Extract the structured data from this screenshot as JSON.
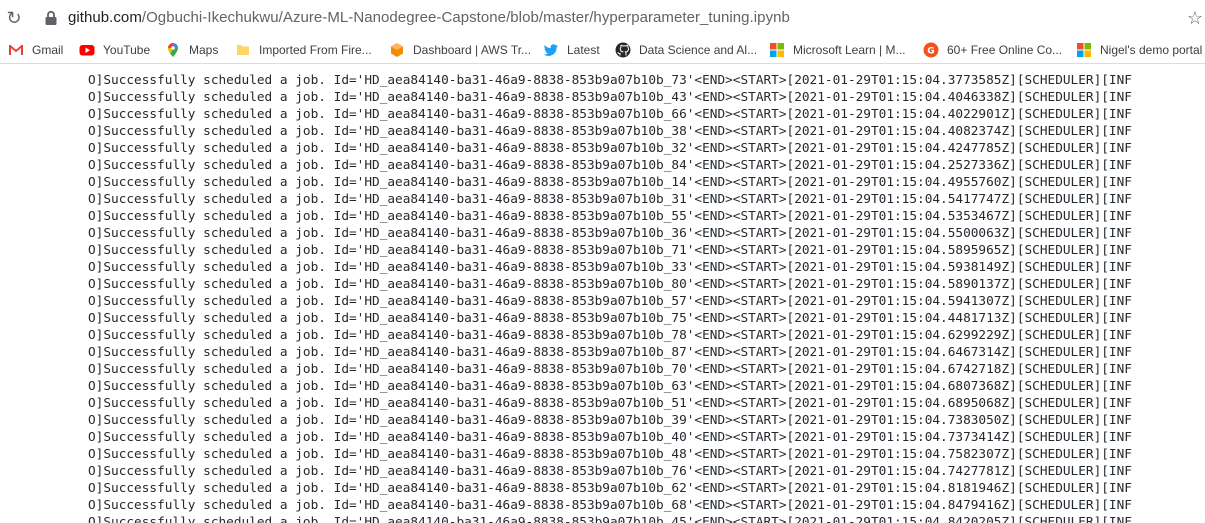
{
  "browser": {
    "url_host": "github.com",
    "url_path": "/Ogbuchi-Ikechukwu/Azure-ML-Nanodegree-Capstone/blob/master/hyperparameter_tuning.ipynb"
  },
  "bookmarks": [
    {
      "label": "Gmail",
      "icon": "gmail-icon"
    },
    {
      "label": "YouTube",
      "icon": "youtube-icon"
    },
    {
      "label": "Maps",
      "icon": "maps-icon"
    },
    {
      "label": "Imported From Fire...",
      "icon": "folder-icon"
    },
    {
      "label": "Dashboard | AWS Tr...",
      "icon": "aws-icon"
    },
    {
      "label": "Latest",
      "icon": "twitter-icon"
    },
    {
      "label": "Data Science and Al...",
      "icon": "github-icon"
    },
    {
      "label": "Microsoft Learn | M...",
      "icon": "microsoft-icon"
    },
    {
      "label": "60+ Free Online Co...",
      "icon": "course-icon"
    },
    {
      "label": "Nigel's demo portal",
      "icon": "microsoft-icon"
    }
  ],
  "output": {
    "lines": [
      "O]Successfully scheduled a job. Id='HD_aea84140-ba31-46a9-8838-853b9a07b10b_73'<END><START>[2021-01-29T01:15:04.3773585Z][SCHEDULER][INF",
      "O]Successfully scheduled a job. Id='HD_aea84140-ba31-46a9-8838-853b9a07b10b_43'<END><START>[2021-01-29T01:15:04.4046338Z][SCHEDULER][INF",
      "O]Successfully scheduled a job. Id='HD_aea84140-ba31-46a9-8838-853b9a07b10b_66'<END><START>[2021-01-29T01:15:04.4022901Z][SCHEDULER][INF",
      "O]Successfully scheduled a job. Id='HD_aea84140-ba31-46a9-8838-853b9a07b10b_38'<END><START>[2021-01-29T01:15:04.4082374Z][SCHEDULER][INF",
      "O]Successfully scheduled a job. Id='HD_aea84140-ba31-46a9-8838-853b9a07b10b_32'<END><START>[2021-01-29T01:15:04.4247785Z][SCHEDULER][INF",
      "O]Successfully scheduled a job. Id='HD_aea84140-ba31-46a9-8838-853b9a07b10b_84'<END><START>[2021-01-29T01:15:04.2527336Z][SCHEDULER][INF",
      "O]Successfully scheduled a job. Id='HD_aea84140-ba31-46a9-8838-853b9a07b10b_14'<END><START>[2021-01-29T01:15:04.4955760Z][SCHEDULER][INF",
      "O]Successfully scheduled a job. Id='HD_aea84140-ba31-46a9-8838-853b9a07b10b_31'<END><START>[2021-01-29T01:15:04.5417747Z][SCHEDULER][INF",
      "O]Successfully scheduled a job. Id='HD_aea84140-ba31-46a9-8838-853b9a07b10b_55'<END><START>[2021-01-29T01:15:04.5353467Z][SCHEDULER][INF",
      "O]Successfully scheduled a job. Id='HD_aea84140-ba31-46a9-8838-853b9a07b10b_36'<END><START>[2021-01-29T01:15:04.5500063Z][SCHEDULER][INF",
      "O]Successfully scheduled a job. Id='HD_aea84140-ba31-46a9-8838-853b9a07b10b_71'<END><START>[2021-01-29T01:15:04.5895965Z][SCHEDULER][INF",
      "O]Successfully scheduled a job. Id='HD_aea84140-ba31-46a9-8838-853b9a07b10b_33'<END><START>[2021-01-29T01:15:04.5938149Z][SCHEDULER][INF",
      "O]Successfully scheduled a job. Id='HD_aea84140-ba31-46a9-8838-853b9a07b10b_80'<END><START>[2021-01-29T01:15:04.5890137Z][SCHEDULER][INF",
      "O]Successfully scheduled a job. Id='HD_aea84140-ba31-46a9-8838-853b9a07b10b_57'<END><START>[2021-01-29T01:15:04.5941307Z][SCHEDULER][INF",
      "O]Successfully scheduled a job. Id='HD_aea84140-ba31-46a9-8838-853b9a07b10b_75'<END><START>[2021-01-29T01:15:04.4481713Z][SCHEDULER][INF",
      "O]Successfully scheduled a job. Id='HD_aea84140-ba31-46a9-8838-853b9a07b10b_78'<END><START>[2021-01-29T01:15:04.6299229Z][SCHEDULER][INF",
      "O]Successfully scheduled a job. Id='HD_aea84140-ba31-46a9-8838-853b9a07b10b_87'<END><START>[2021-01-29T01:15:04.6467314Z][SCHEDULER][INF",
      "O]Successfully scheduled a job. Id='HD_aea84140-ba31-46a9-8838-853b9a07b10b_70'<END><START>[2021-01-29T01:15:04.6742718Z][SCHEDULER][INF",
      "O]Successfully scheduled a job. Id='HD_aea84140-ba31-46a9-8838-853b9a07b10b_63'<END><START>[2021-01-29T01:15:04.6807368Z][SCHEDULER][INF",
      "O]Successfully scheduled a job. Id='HD_aea84140-ba31-46a9-8838-853b9a07b10b_51'<END><START>[2021-01-29T01:15:04.6895068Z][SCHEDULER][INF",
      "O]Successfully scheduled a job. Id='HD_aea84140-ba31-46a9-8838-853b9a07b10b_39'<END><START>[2021-01-29T01:15:04.7383050Z][SCHEDULER][INF",
      "O]Successfully scheduled a job. Id='HD_aea84140-ba31-46a9-8838-853b9a07b10b_40'<END><START>[2021-01-29T01:15:04.7373414Z][SCHEDULER][INF",
      "O]Successfully scheduled a job. Id='HD_aea84140-ba31-46a9-8838-853b9a07b10b_48'<END><START>[2021-01-29T01:15:04.7582307Z][SCHEDULER][INF",
      "O]Successfully scheduled a job. Id='HD_aea84140-ba31-46a9-8838-853b9a07b10b_76'<END><START>[2021-01-29T01:15:04.7427781Z][SCHEDULER][INF",
      "O]Successfully scheduled a job. Id='HD_aea84140-ba31-46a9-8838-853b9a07b10b_62'<END><START>[2021-01-29T01:15:04.8181946Z][SCHEDULER][INF",
      "O]Successfully scheduled a job. Id='HD_aea84140-ba31-46a9-8838-853b9a07b10b_68'<END><START>[2021-01-29T01:15:04.8479416Z][SCHEDULER][INF",
      "O]Successfully scheduled a job. Id='HD_aea84140-ba31-46a9-8838-853b9a07b10b_45'<END><START>[2021-01-29T01:15:04.8420205Z][SCHEDULER][INF"
    ]
  }
}
